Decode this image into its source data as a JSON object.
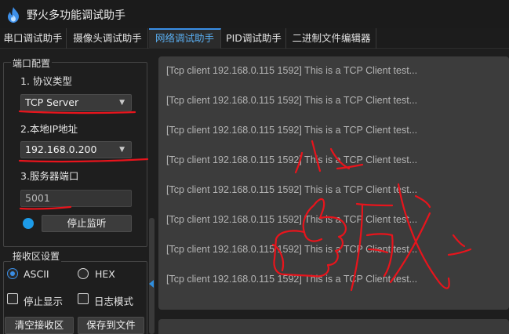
{
  "window": {
    "title": "野火多功能调试助手"
  },
  "tabs": [
    {
      "label": "串口调试助手"
    },
    {
      "label": "摄像头调试助手"
    },
    {
      "label": "网络调试助手",
      "active": true
    },
    {
      "label": "PID调试助手"
    },
    {
      "label": "二进制文件编辑器"
    }
  ],
  "port_config": {
    "group_title": "端口配置",
    "protocol_label": "1. 协议类型",
    "protocol_value": "TCP Server",
    "local_ip_label": "2.本地IP地址",
    "local_ip_value": "192.168.0.200",
    "port_label": "3.服务器端口",
    "port_value": "5001",
    "status_color": "#1d9be8",
    "stop_button": "停止监听"
  },
  "recv_settings": {
    "group_title": "接收区设置",
    "ascii_label": "ASCII",
    "hex_label": "HEX",
    "ascii_checked": true,
    "stop_display_label": "停止显示",
    "log_mode_label": "日志模式",
    "clear_button": "清空接收区",
    "save_button": "保存到文件"
  },
  "receive_lines": [
    "[Tcp client 192.168.0.115 1592] This is a TCP Client test...",
    "[Tcp client 192.168.0.115 1592] This is a TCP Client test...",
    "[Tcp client 192.168.0.115 1592] This is a TCP Client test...",
    "[Tcp client 192.168.0.115 1592] This is a TCP Client test...",
    "[Tcp client 192.168.0.115 1592] This is a TCP Client test...",
    "[Tcp client 192.168.0.115 1592] This is a TCP Client test...",
    "[Tcp client 192.168.0.115 1592] This is a TCP Client test...",
    "[Tcp client 192.168.0.115 1592] This is a TCP Client test..."
  ],
  "colors": {
    "accent": "#3a8ee6",
    "annotation": "#e8141c"
  }
}
